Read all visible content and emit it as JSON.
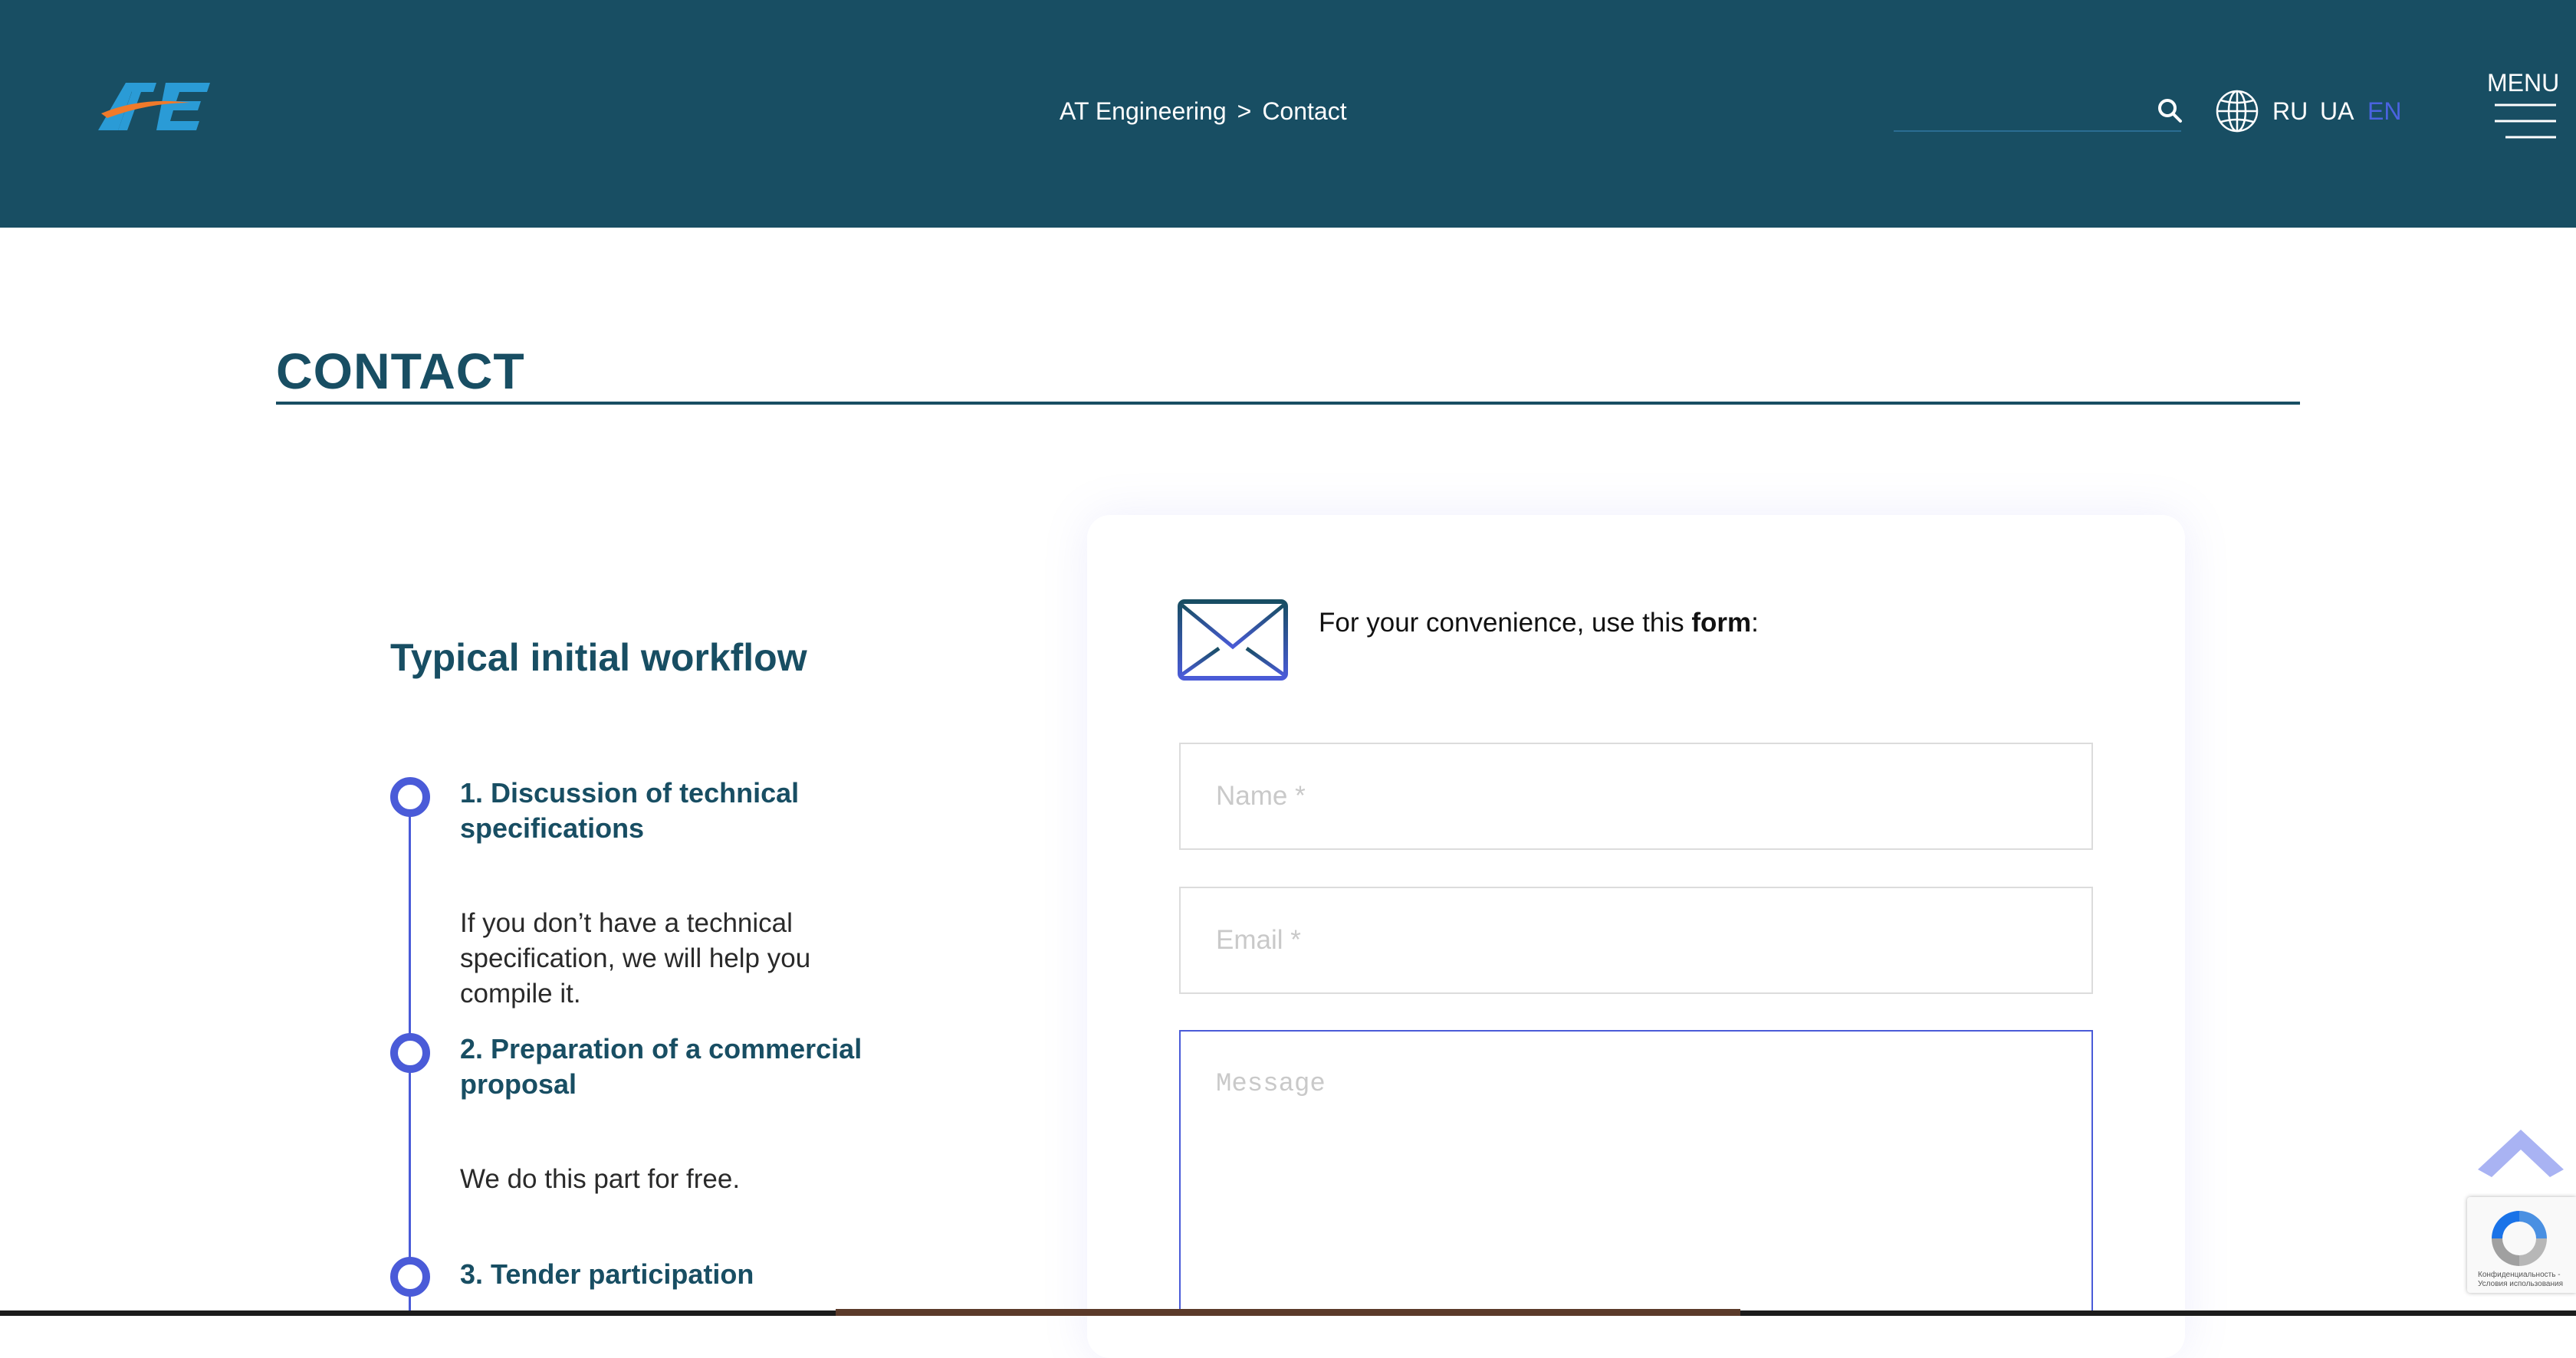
{
  "header": {
    "breadcrumb": {
      "home": "AT Engineering",
      "separator": ">",
      "current": "Contact"
    },
    "languages": [
      {
        "code": "RU",
        "active": false
      },
      {
        "code": "UA",
        "active": false
      },
      {
        "code": "EN",
        "active": true
      }
    ],
    "menu_label": "MENU",
    "icons": {
      "logo": "ate-logo",
      "search": "search-icon",
      "globe": "globe-icon",
      "menu": "hamburger-icon"
    }
  },
  "page": {
    "title": "CONTACT"
  },
  "workflow": {
    "title": "Typical initial workflow",
    "steps": [
      {
        "title": "1. Discussion of technical specifications",
        "description": "If you don’t have a technical specification, we will help you compile it."
      },
      {
        "title": "2. Preparation of a commercial proposal",
        "description": "We do this part for free."
      },
      {
        "title": "3. Tender participation",
        "description": ""
      }
    ]
  },
  "form": {
    "intro_prefix": "For your convenience, use this ",
    "intro_bold": "form",
    "intro_suffix": ":",
    "name_placeholder": "Name *",
    "email_placeholder": "Email *",
    "message_placeholder": "Message"
  },
  "recaptcha": {
    "text": "Конфиденциальность - Условия использования"
  },
  "colors": {
    "header_bg": "#184e63",
    "accent_blue": "#4a5bd8",
    "logo_orange": "#f07a2a",
    "logo_blue": "#2a9bd6"
  }
}
